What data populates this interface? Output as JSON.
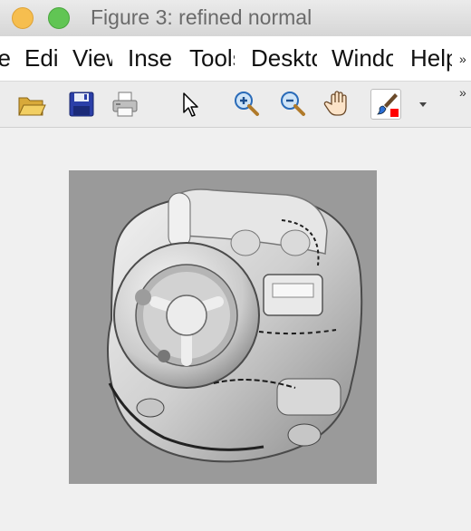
{
  "window": {
    "title": "Figure 3: refined normal"
  },
  "menubar": {
    "items": [
      {
        "label": "File"
      },
      {
        "label": "Edit"
      },
      {
        "label": "View"
      },
      {
        "label": "Insert"
      },
      {
        "label": "Tools"
      },
      {
        "label": "Desktop"
      },
      {
        "label": "Window"
      },
      {
        "label": "Help"
      }
    ],
    "overflow_label": "»"
  },
  "toolbar": {
    "tools": [
      {
        "name": "open-file",
        "icon": "folder-open-icon"
      },
      {
        "name": "save-figure",
        "icon": "floppy-disk-icon"
      },
      {
        "name": "print-figure",
        "icon": "printer-icon"
      },
      {
        "name": "edit-plot",
        "icon": "arrow-pointer-icon"
      },
      {
        "name": "zoom-in",
        "icon": "zoom-in-icon"
      },
      {
        "name": "zoom-out",
        "icon": "zoom-out-icon"
      },
      {
        "name": "pan",
        "icon": "hand-icon"
      },
      {
        "name": "brush",
        "icon": "brush-icon",
        "selected": true
      }
    ],
    "overflow_label": "»",
    "dropdown_icon": "chevron-down-icon"
  },
  "colors": {
    "title_text": "#6a6a6a",
    "traffic_yellow": "#f6be4f",
    "traffic_green": "#61c554",
    "brush_red": "#ff0000",
    "canvas_bg": "#f0f0f0",
    "image_bg": "#9a9a9a"
  },
  "figure": {
    "content": "grayscale normal-map rendering of a toy car"
  }
}
